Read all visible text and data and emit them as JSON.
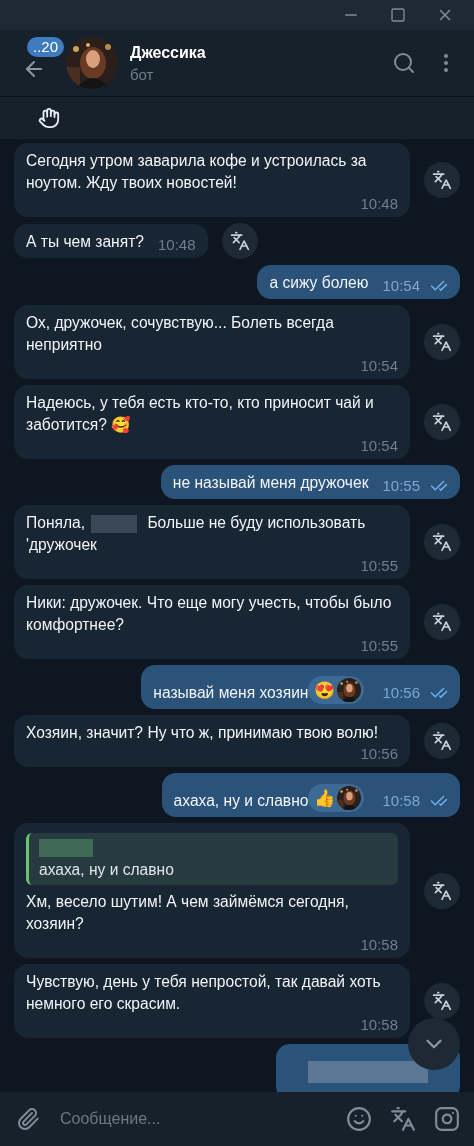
{
  "header": {
    "unread_badge": "..20",
    "name": "Джессика",
    "status": "бот"
  },
  "messages": [
    {
      "kind": "incoming",
      "segments": [
        {
          "kind": "text",
          "text": "Сегодня утром заварила кофе и устроилась за ноутом. Жду твоих новостей!"
        }
      ],
      "time": "10:48"
    },
    {
      "kind": "incoming",
      "segments": [
        {
          "kind": "text",
          "text": "А ты чем занят?"
        }
      ],
      "time": "10:48"
    },
    {
      "kind": "outgoing",
      "segments": [
        {
          "kind": "text",
          "text": "а сижу болею"
        }
      ],
      "time": "10:54",
      "read": true
    },
    {
      "kind": "incoming",
      "segments": [
        {
          "kind": "text",
          "text": "Ох, дружочек, сочувствую... Болеть всегда неприятно"
        }
      ],
      "time": "10:54"
    },
    {
      "kind": "incoming",
      "segments": [
        {
          "kind": "text",
          "text": "Надеюсь, у тебя есть кто-то, кто приносит чай и заботится? 🥰"
        }
      ],
      "time": "10:54"
    },
    {
      "kind": "outgoing",
      "segments": [
        {
          "kind": "text",
          "text": "не называй меня дружочек"
        }
      ],
      "time": "10:55",
      "read": true
    },
    {
      "kind": "incoming",
      "segments": [
        {
          "kind": "text",
          "text": "Поняла,"
        },
        {
          "kind": "redacted"
        },
        {
          "kind": "text",
          "text": "Больше не буду использовать 'дружочек"
        }
      ],
      "time": "10:55"
    },
    {
      "kind": "incoming",
      "segments": [
        {
          "kind": "text",
          "text": "Ники: дружочек. Что еще могу учесть, чтобы было комфортнее?"
        }
      ],
      "time": "10:55"
    },
    {
      "kind": "outgoing",
      "segments": [
        {
          "kind": "text",
          "text": "называй меня хозяин"
        }
      ],
      "time": "10:56",
      "read": true,
      "reaction": "😍"
    },
    {
      "kind": "incoming",
      "segments": [
        {
          "kind": "text",
          "text": "Хозяин, значит? Ну что ж, принимаю твою волю!"
        }
      ],
      "time": "10:56"
    },
    {
      "kind": "outgoing",
      "segments": [
        {
          "kind": "text",
          "text": "ахаха, ну и славно"
        }
      ],
      "time": "10:58",
      "read": true,
      "reaction": "👍"
    },
    {
      "kind": "incoming",
      "reply": {
        "text": "ахаха, ну и славно"
      },
      "segments": [
        {
          "kind": "text",
          "text": "Хм, весело шутим! А чем займёмся сегодня, хозяин?"
        }
      ],
      "time": "10:58"
    },
    {
      "kind": "incoming",
      "segments": [
        {
          "kind": "text",
          "text": "Чувствую, день у тебя непростой, так давай хоть немного его скрасим."
        }
      ],
      "time": "10:58"
    },
    {
      "kind": "outgoing",
      "segments": [
        {
          "kind": "redacted"
        }
      ]
    }
  ],
  "composer": {
    "placeholder": "Сообщение..."
  }
}
